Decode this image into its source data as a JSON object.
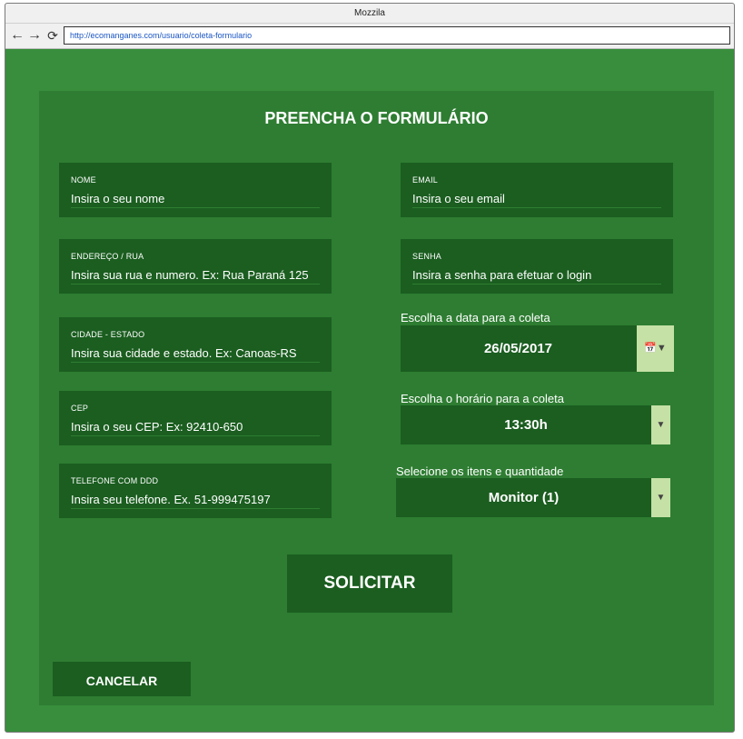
{
  "browser": {
    "title": "Mozzila",
    "url": "http://ecomanganes.com/usuario/coleta-formulario",
    "back_icon": "arrow-left",
    "forward_icon": "arrow-right",
    "reload_icon": "reload"
  },
  "form": {
    "title": "PREENCHA O FORMULÁRIO",
    "fields": {
      "nome": {
        "label": "NOME",
        "placeholder": "Insira o seu nome"
      },
      "email": {
        "label": "EMAIL",
        "placeholder": "Insira o seu email"
      },
      "endereco": {
        "label": "ENDEREÇO / RUA",
        "placeholder": "Insira sua rua e numero. Ex: Rua Paraná 125"
      },
      "senha": {
        "label": "SENHA",
        "placeholder": "Insira a senha para efetuar o login"
      },
      "cidade": {
        "label": "CIDADE - ESTADO",
        "placeholder": "Insira sua cidade e estado. Ex: Canoas-RS"
      },
      "cep": {
        "label": "CEP",
        "placeholder": "Insira o seu CEP: Ex: 92410-650"
      },
      "telefone": {
        "label": "TELEFONE COM DDD",
        "placeholder": "Insira seu telefone. Ex. 51-999475197"
      }
    },
    "date": {
      "label": "Escolha a data para a coleta",
      "value": "26/05/2017",
      "icon": "calendar"
    },
    "time": {
      "label": "Escolha o horário para a coleta",
      "value": "13:30h"
    },
    "items": {
      "label": "Selecione os itens e quantidade",
      "value": "Monitor (1)"
    },
    "submit_label": "SOLICITAR",
    "cancel_label": "CANCELAR"
  },
  "colors": {
    "page_bg": "#388e3c",
    "panel_bg": "#2e7d32",
    "field_bg": "#1b5e20",
    "accent": "#c5e1a5",
    "text": "#ffffff"
  }
}
